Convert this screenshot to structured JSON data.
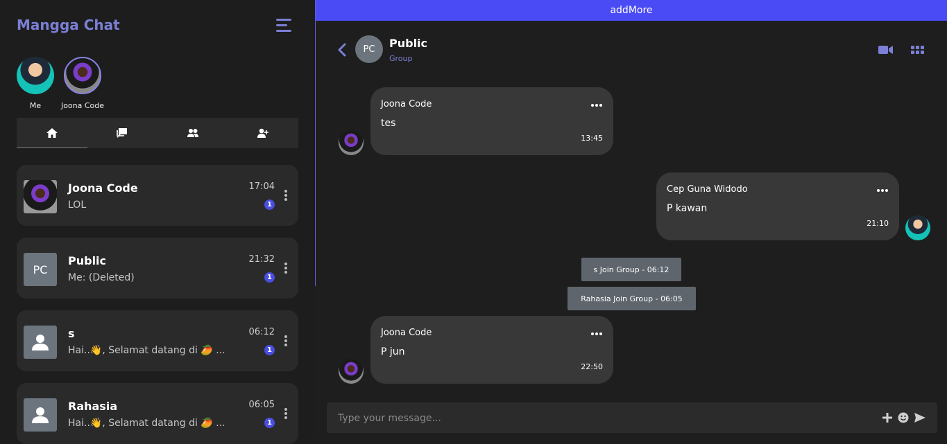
{
  "brand": "Mangga Chat",
  "stories": [
    {
      "label": "Me"
    },
    {
      "label": "Joona Code"
    }
  ],
  "tabs": [
    "home-icon",
    "chat-icon",
    "group-icon",
    "add-user-icon"
  ],
  "chats": [
    {
      "name": "Joona Code",
      "msg": "LOL",
      "time": "17:04",
      "badge": "1",
      "thumb": "image"
    },
    {
      "name": "Public",
      "msg": "Me: (Deleted)",
      "time": "21:32",
      "badge": "1",
      "thumb": "PC"
    },
    {
      "name": "s",
      "msg": "Hai..👋, Selamat datang di 🥭 ...",
      "time": "06:12",
      "badge": "1",
      "thumb": "user-icon"
    },
    {
      "name": "Rahasia",
      "msg": "Hai..👋, Selamat datang di 🥭 ...",
      "time": "06:05",
      "badge": "1",
      "thumb": "user-icon"
    }
  ],
  "topbar": "addMore",
  "header": {
    "avatar": "PC",
    "title": "Public",
    "subtitle": "Group"
  },
  "messages": [
    {
      "sender": "Joona Code",
      "text": "tes",
      "time": "13:45"
    },
    {
      "sender": "Cep Guna Widodo",
      "text": "P kawan",
      "time": "21:10"
    },
    {
      "sender": "Joona Code",
      "text": "P jun",
      "time": "22:50"
    }
  ],
  "system": [
    "s Join Group - 06:12",
    "Rahasia Join Group - 06:05"
  ],
  "composer": {
    "placeholder": "Type your message..."
  },
  "colors": {
    "accent": "#7c7fd6",
    "topbar": "#4b4bf5",
    "badge": "#4a4ee0"
  }
}
